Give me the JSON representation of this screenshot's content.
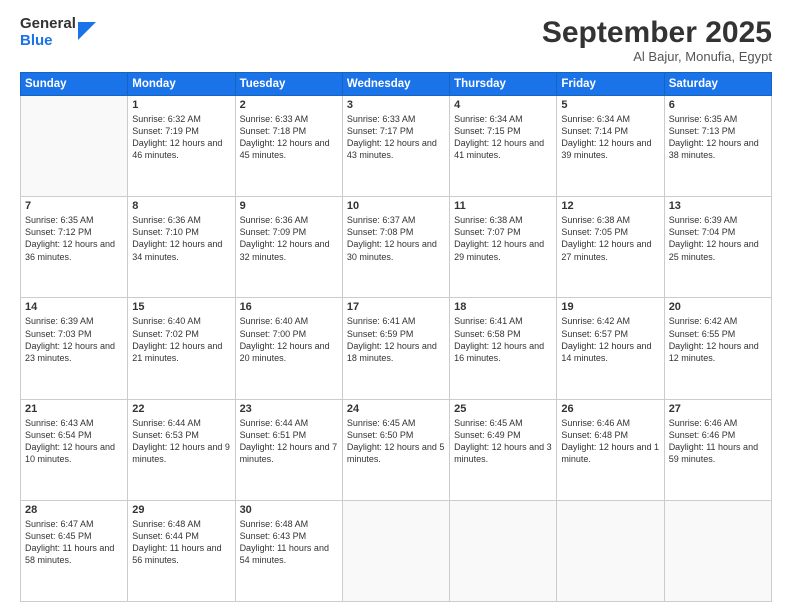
{
  "header": {
    "logo_general": "General",
    "logo_blue": "Blue",
    "month": "September 2025",
    "location": "Al Bajur, Monufia, Egypt"
  },
  "weekdays": [
    "Sunday",
    "Monday",
    "Tuesday",
    "Wednesday",
    "Thursday",
    "Friday",
    "Saturday"
  ],
  "weeks": [
    [
      {
        "day": "",
        "sunrise": "",
        "sunset": "",
        "daylight": ""
      },
      {
        "day": "1",
        "sunrise": "Sunrise: 6:32 AM",
        "sunset": "Sunset: 7:19 PM",
        "daylight": "Daylight: 12 hours and 46 minutes."
      },
      {
        "day": "2",
        "sunrise": "Sunrise: 6:33 AM",
        "sunset": "Sunset: 7:18 PM",
        "daylight": "Daylight: 12 hours and 45 minutes."
      },
      {
        "day": "3",
        "sunrise": "Sunrise: 6:33 AM",
        "sunset": "Sunset: 7:17 PM",
        "daylight": "Daylight: 12 hours and 43 minutes."
      },
      {
        "day": "4",
        "sunrise": "Sunrise: 6:34 AM",
        "sunset": "Sunset: 7:15 PM",
        "daylight": "Daylight: 12 hours and 41 minutes."
      },
      {
        "day": "5",
        "sunrise": "Sunrise: 6:34 AM",
        "sunset": "Sunset: 7:14 PM",
        "daylight": "Daylight: 12 hours and 39 minutes."
      },
      {
        "day": "6",
        "sunrise": "Sunrise: 6:35 AM",
        "sunset": "Sunset: 7:13 PM",
        "daylight": "Daylight: 12 hours and 38 minutes."
      }
    ],
    [
      {
        "day": "7",
        "sunrise": "Sunrise: 6:35 AM",
        "sunset": "Sunset: 7:12 PM",
        "daylight": "Daylight: 12 hours and 36 minutes."
      },
      {
        "day": "8",
        "sunrise": "Sunrise: 6:36 AM",
        "sunset": "Sunset: 7:10 PM",
        "daylight": "Daylight: 12 hours and 34 minutes."
      },
      {
        "day": "9",
        "sunrise": "Sunrise: 6:36 AM",
        "sunset": "Sunset: 7:09 PM",
        "daylight": "Daylight: 12 hours and 32 minutes."
      },
      {
        "day": "10",
        "sunrise": "Sunrise: 6:37 AM",
        "sunset": "Sunset: 7:08 PM",
        "daylight": "Daylight: 12 hours and 30 minutes."
      },
      {
        "day": "11",
        "sunrise": "Sunrise: 6:38 AM",
        "sunset": "Sunset: 7:07 PM",
        "daylight": "Daylight: 12 hours and 29 minutes."
      },
      {
        "day": "12",
        "sunrise": "Sunrise: 6:38 AM",
        "sunset": "Sunset: 7:05 PM",
        "daylight": "Daylight: 12 hours and 27 minutes."
      },
      {
        "day": "13",
        "sunrise": "Sunrise: 6:39 AM",
        "sunset": "Sunset: 7:04 PM",
        "daylight": "Daylight: 12 hours and 25 minutes."
      }
    ],
    [
      {
        "day": "14",
        "sunrise": "Sunrise: 6:39 AM",
        "sunset": "Sunset: 7:03 PM",
        "daylight": "Daylight: 12 hours and 23 minutes."
      },
      {
        "day": "15",
        "sunrise": "Sunrise: 6:40 AM",
        "sunset": "Sunset: 7:02 PM",
        "daylight": "Daylight: 12 hours and 21 minutes."
      },
      {
        "day": "16",
        "sunrise": "Sunrise: 6:40 AM",
        "sunset": "Sunset: 7:00 PM",
        "daylight": "Daylight: 12 hours and 20 minutes."
      },
      {
        "day": "17",
        "sunrise": "Sunrise: 6:41 AM",
        "sunset": "Sunset: 6:59 PM",
        "daylight": "Daylight: 12 hours and 18 minutes."
      },
      {
        "day": "18",
        "sunrise": "Sunrise: 6:41 AM",
        "sunset": "Sunset: 6:58 PM",
        "daylight": "Daylight: 12 hours and 16 minutes."
      },
      {
        "day": "19",
        "sunrise": "Sunrise: 6:42 AM",
        "sunset": "Sunset: 6:57 PM",
        "daylight": "Daylight: 12 hours and 14 minutes."
      },
      {
        "day": "20",
        "sunrise": "Sunrise: 6:42 AM",
        "sunset": "Sunset: 6:55 PM",
        "daylight": "Daylight: 12 hours and 12 minutes."
      }
    ],
    [
      {
        "day": "21",
        "sunrise": "Sunrise: 6:43 AM",
        "sunset": "Sunset: 6:54 PM",
        "daylight": "Daylight: 12 hours and 10 minutes."
      },
      {
        "day": "22",
        "sunrise": "Sunrise: 6:44 AM",
        "sunset": "Sunset: 6:53 PM",
        "daylight": "Daylight: 12 hours and 9 minutes."
      },
      {
        "day": "23",
        "sunrise": "Sunrise: 6:44 AM",
        "sunset": "Sunset: 6:51 PM",
        "daylight": "Daylight: 12 hours and 7 minutes."
      },
      {
        "day": "24",
        "sunrise": "Sunrise: 6:45 AM",
        "sunset": "Sunset: 6:50 PM",
        "daylight": "Daylight: 12 hours and 5 minutes."
      },
      {
        "day": "25",
        "sunrise": "Sunrise: 6:45 AM",
        "sunset": "Sunset: 6:49 PM",
        "daylight": "Daylight: 12 hours and 3 minutes."
      },
      {
        "day": "26",
        "sunrise": "Sunrise: 6:46 AM",
        "sunset": "Sunset: 6:48 PM",
        "daylight": "Daylight: 12 hours and 1 minute."
      },
      {
        "day": "27",
        "sunrise": "Sunrise: 6:46 AM",
        "sunset": "Sunset: 6:46 PM",
        "daylight": "Daylight: 11 hours and 59 minutes."
      }
    ],
    [
      {
        "day": "28",
        "sunrise": "Sunrise: 6:47 AM",
        "sunset": "Sunset: 6:45 PM",
        "daylight": "Daylight: 11 hours and 58 minutes."
      },
      {
        "day": "29",
        "sunrise": "Sunrise: 6:48 AM",
        "sunset": "Sunset: 6:44 PM",
        "daylight": "Daylight: 11 hours and 56 minutes."
      },
      {
        "day": "30",
        "sunrise": "Sunrise: 6:48 AM",
        "sunset": "Sunset: 6:43 PM",
        "daylight": "Daylight: 11 hours and 54 minutes."
      },
      {
        "day": "",
        "sunrise": "",
        "sunset": "",
        "daylight": ""
      },
      {
        "day": "",
        "sunrise": "",
        "sunset": "",
        "daylight": ""
      },
      {
        "day": "",
        "sunrise": "",
        "sunset": "",
        "daylight": ""
      },
      {
        "day": "",
        "sunrise": "",
        "sunset": "",
        "daylight": ""
      }
    ]
  ]
}
